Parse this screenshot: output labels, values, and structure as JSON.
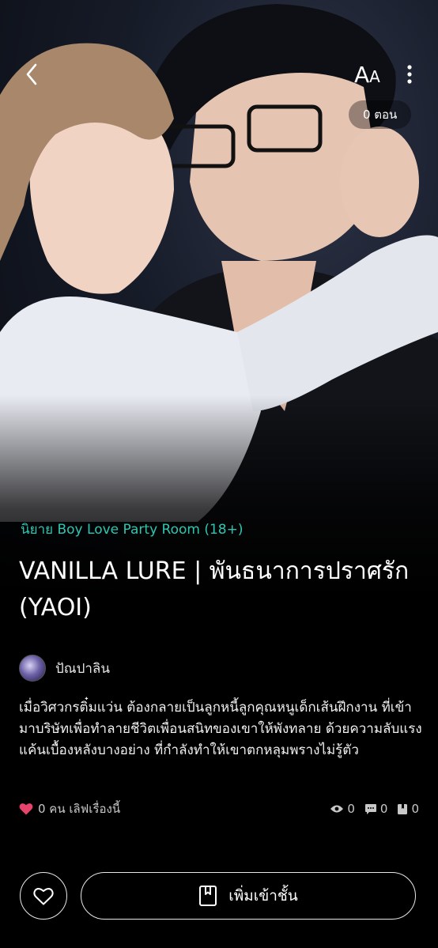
{
  "header": {
    "font_button_large": "A",
    "font_button_small": "A",
    "episodes_count": "0 ตอน"
  },
  "novel": {
    "category": "นิยาย Boy Love Party Room (18+)",
    "title": "VANILLA LURE | พันธนาการปราศรัก (YAOI)",
    "author": "ปัณปาลิน",
    "synopsis": "เมื่อวิศวกรติ๋มแว่น ต้องกลายเป็นลูกหนี้ลูกคุณหนูเด็กเส้นฝึกงาน ที่เข้ามาบริษัทเพื่อทำลายชีวิตเพื่อนสนิทของเขาให้พังทลาย ด้วยความลับแรงแค้นเบื้องหลังบางอย่าง ที่กำลังทำให้เขาตกหลุมพรางไม่รู้ตัว"
  },
  "stats": {
    "likes_text": "0 คน เลิฟเรื่องนี้",
    "views": "0",
    "comments": "0",
    "bookmarks": "0"
  },
  "actions": {
    "add_to_shelf": "เพิ่มเข้าชั้น"
  },
  "colors": {
    "category": "#2cc7b1",
    "heart": "#e8436b",
    "background": "#000000"
  },
  "icons": [
    "back-chevron-icon",
    "font-size-icon",
    "more-vertical-icon",
    "heart-icon",
    "eye-icon",
    "comment-icon",
    "bookmark-icon",
    "heart-outline-icon",
    "book-icon"
  ]
}
